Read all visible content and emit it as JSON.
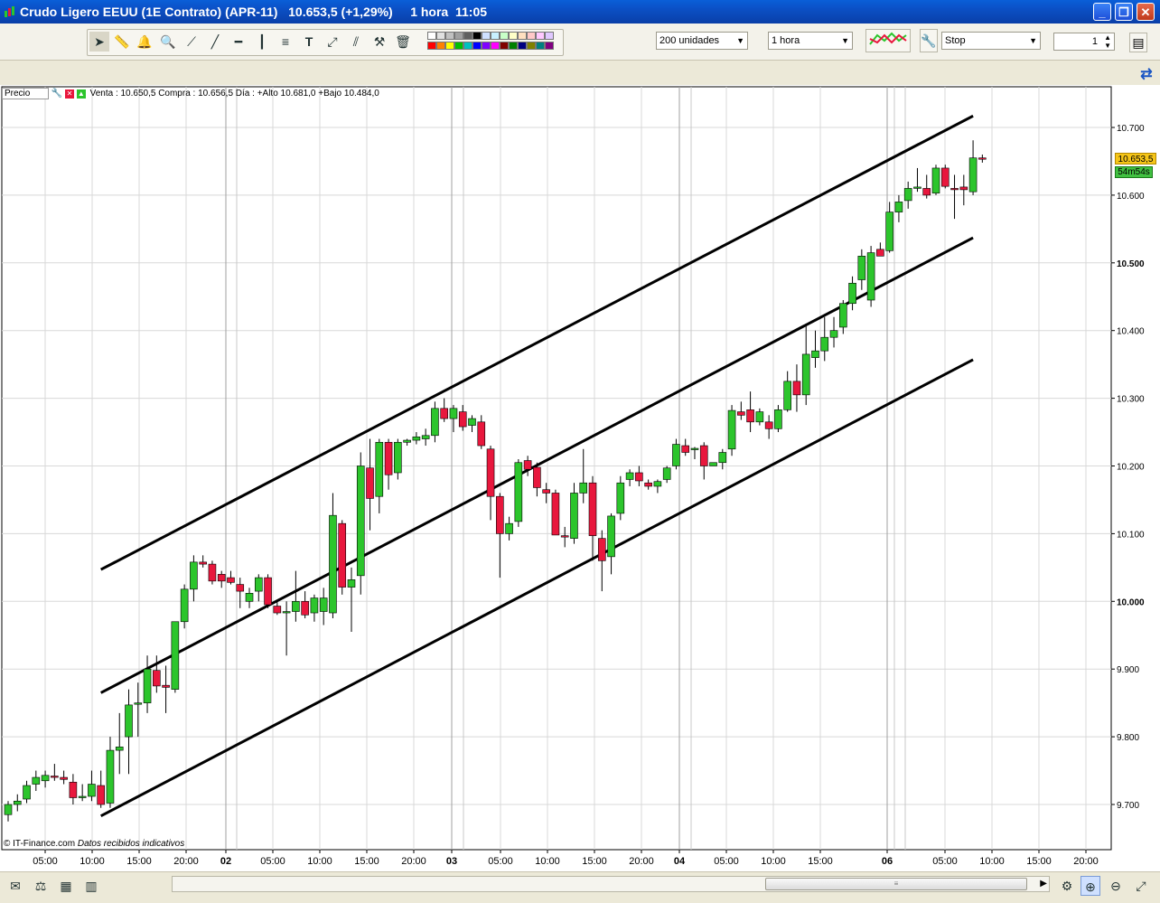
{
  "window": {
    "title_parts": [
      "Crudo Ligero EEUU (1E Contrato) (APR-11)",
      "10.653,5 (+1,29%)",
      "1 hora",
      "11:05"
    ]
  },
  "toolbar": {
    "quantity_select": "200 unidades",
    "period_select": "1 hora",
    "order_type_select": "Stop",
    "order_quantity": "1",
    "tools": [
      "pointer-icon",
      "ruler-icon",
      "alert-bell-icon",
      "zoom-icon",
      "line-icon",
      "trendline-icon",
      "horizontal-line-icon",
      "vertical-line-icon",
      "fibonacci-icon",
      "text-icon",
      "channel-icon",
      "parallel-lines-icon",
      "tools-icon",
      "trash-icon"
    ],
    "palette_colors": [
      "#ffffff",
      "#e0e0e0",
      "#c0c0c0",
      "#a0a0a0",
      "#606060",
      "#000000",
      "#cfe0ff",
      "#c8f0ff",
      "#c8ffc8",
      "#ffffc8",
      "#ffe0c0",
      "#ffc8c8",
      "#ffc8ff",
      "#e0c8ff",
      "#ff0000",
      "#ff8000",
      "#ffff00",
      "#00c000",
      "#00c0c0",
      "#0000ff",
      "#8000ff",
      "#ff00ff",
      "#800000",
      "#008000",
      "#000080",
      "#808000",
      "#008080",
      "#800080"
    ]
  },
  "chart_header": {
    "panel_label": "Precio",
    "quote_line": "Venta : 10.650,5 Compra : 10.656,5  Día : +Alto 10.681,0 +Bajo 10.484,0"
  },
  "chart_footer": {
    "copyright": "© IT-Finance.com",
    "note": "Datos recibidos indicativos"
  },
  "price_axis": {
    "last_price": "10.653,5",
    "countdown": "54m54s",
    "labels": [
      "10.700",
      "10.600",
      "10.500",
      "10.400",
      "10.300",
      "10.200",
      "10.100",
      "10.000",
      "9.900",
      "9.800",
      "9.700"
    ]
  },
  "time_axis": {
    "labels": [
      "05:00",
      "10:00",
      "15:00",
      "20:00",
      "02",
      "05:00",
      "10:00",
      "15:00",
      "20:00",
      "03",
      "05:00",
      "10:00",
      "15:00",
      "20:00",
      "04",
      "05:00",
      "10:00",
      "15:00",
      "06",
      "05:00",
      "10:00",
      "15:00",
      "20:00"
    ],
    "bold_labels": [
      "02",
      "03",
      "04",
      "06"
    ]
  },
  "colors": {
    "bull": "#2cc52c",
    "bear": "#e8173d",
    "grid": "#d8d8d8",
    "channel": "#000000",
    "last_price_bg": "#f5c518",
    "countdown_bg": "#41c041"
  },
  "statusbar": {
    "icons": [
      "mail-icon",
      "scales-icon",
      "calculator-icon",
      "chart-type-icon",
      "zoom-in-icon",
      "zoom-out-icon",
      "expand-icon"
    ]
  },
  "chart_data": {
    "type": "candlestick",
    "title": "Crudo Ligero EEUU (1E Contrato) (APR-11)",
    "timeframe": "1 hora",
    "y_range": [
      9.66,
      10.74
    ],
    "candles": [
      {
        "o": 9.685,
        "h": 9.705,
        "l": 9.675,
        "c": 9.7
      },
      {
        "o": 9.7,
        "h": 9.715,
        "l": 9.69,
        "c": 9.705
      },
      {
        "o": 9.708,
        "h": 9.735,
        "l": 9.702,
        "c": 9.728
      },
      {
        "o": 9.73,
        "h": 9.75,
        "l": 9.72,
        "c": 9.74
      },
      {
        "o": 9.735,
        "h": 9.75,
        "l": 9.725,
        "c": 9.743
      },
      {
        "o": 9.742,
        "h": 9.76,
        "l": 9.735,
        "c": 9.74
      },
      {
        "o": 9.74,
        "h": 9.75,
        "l": 9.73,
        "c": 9.737
      },
      {
        "o": 9.733,
        "h": 9.745,
        "l": 9.7,
        "c": 9.71
      },
      {
        "o": 9.71,
        "h": 9.73,
        "l": 9.705,
        "c": 9.712
      },
      {
        "o": 9.712,
        "h": 9.75,
        "l": 9.705,
        "c": 9.73
      },
      {
        "o": 9.728,
        "h": 9.75,
        "l": 9.695,
        "c": 9.7
      },
      {
        "o": 9.702,
        "h": 9.8,
        "l": 9.695,
        "c": 9.78
      },
      {
        "o": 9.78,
        "h": 9.835,
        "l": 9.745,
        "c": 9.785
      },
      {
        "o": 9.8,
        "h": 9.87,
        "l": 9.745,
        "c": 9.847
      },
      {
        "o": 9.848,
        "h": 9.88,
        "l": 9.8,
        "c": 9.85
      },
      {
        "o": 9.85,
        "h": 9.92,
        "l": 9.835,
        "c": 9.9
      },
      {
        "o": 9.898,
        "h": 9.92,
        "l": 9.865,
        "c": 9.875
      },
      {
        "o": 9.876,
        "h": 9.905,
        "l": 9.835,
        "c": 9.873
      },
      {
        "o": 9.87,
        "h": 9.97,
        "l": 9.865,
        "c": 9.97
      },
      {
        "o": 9.97,
        "h": 10.025,
        "l": 9.96,
        "c": 10.018
      },
      {
        "o": 10.018,
        "h": 10.068,
        "l": 10.0,
        "c": 10.058
      },
      {
        "o": 10.058,
        "h": 10.068,
        "l": 10.05,
        "c": 10.055
      },
      {
        "o": 10.055,
        "h": 10.06,
        "l": 10.025,
        "c": 10.03
      },
      {
        "o": 10.04,
        "h": 10.045,
        "l": 10.02,
        "c": 10.03
      },
      {
        "o": 10.035,
        "h": 10.045,
        "l": 10.025,
        "c": 10.028
      },
      {
        "o": 10.025,
        "h": 10.035,
        "l": 9.99,
        "c": 10.015
      },
      {
        "o": 10.0,
        "h": 10.02,
        "l": 9.99,
        "c": 10.012
      },
      {
        "o": 10.015,
        "h": 10.04,
        "l": 10.0,
        "c": 10.035
      },
      {
        "o": 10.035,
        "h": 10.04,
        "l": 9.99,
        "c": 9.995
      },
      {
        "o": 9.993,
        "h": 10.0,
        "l": 9.98,
        "c": 9.983
      },
      {
        "o": 9.985,
        "h": 10.0,
        "l": 9.92,
        "c": 9.985
      },
      {
        "o": 9.985,
        "h": 10.045,
        "l": 9.97,
        "c": 10.0
      },
      {
        "o": 10.0,
        "h": 10.015,
        "l": 9.975,
        "c": 9.98
      },
      {
        "o": 9.983,
        "h": 10.01,
        "l": 9.97,
        "c": 10.005
      },
      {
        "o": 9.985,
        "h": 10.02,
        "l": 9.965,
        "c": 10.005
      },
      {
        "o": 9.983,
        "h": 10.16,
        "l": 9.975,
        "c": 10.127
      },
      {
        "o": 10.115,
        "h": 10.12,
        "l": 10.01,
        "c": 10.021
      },
      {
        "o": 10.021,
        "h": 10.05,
        "l": 9.955,
        "c": 10.032
      },
      {
        "o": 10.038,
        "h": 10.22,
        "l": 10.01,
        "c": 10.2
      },
      {
        "o": 10.197,
        "h": 10.24,
        "l": 10.105,
        "c": 10.152
      },
      {
        "o": 10.155,
        "h": 10.24,
        "l": 10.13,
        "c": 10.235
      },
      {
        "o": 10.235,
        "h": 10.24,
        "l": 10.165,
        "c": 10.187
      },
      {
        "o": 10.19,
        "h": 10.24,
        "l": 10.18,
        "c": 10.235
      },
      {
        "o": 10.235,
        "h": 10.24,
        "l": 10.23,
        "c": 10.238
      },
      {
        "o": 10.238,
        "h": 10.25,
        "l": 10.232,
        "c": 10.243
      },
      {
        "o": 10.24,
        "h": 10.255,
        "l": 10.23,
        "c": 10.245
      },
      {
        "o": 10.245,
        "h": 10.295,
        "l": 10.235,
        "c": 10.285
      },
      {
        "o": 10.285,
        "h": 10.3,
        "l": 10.265,
        "c": 10.27
      },
      {
        "o": 10.27,
        "h": 10.29,
        "l": 10.25,
        "c": 10.285
      },
      {
        "o": 10.28,
        "h": 10.29,
        "l": 10.252,
        "c": 10.258
      },
      {
        "o": 10.26,
        "h": 10.275,
        "l": 10.25,
        "c": 10.27
      },
      {
        "o": 10.265,
        "h": 10.275,
        "l": 10.225,
        "c": 10.23
      },
      {
        "o": 10.225,
        "h": 10.23,
        "l": 10.12,
        "c": 10.155
      },
      {
        "o": 10.155,
        "h": 10.16,
        "l": 10.035,
        "c": 10.1
      },
      {
        "o": 10.1,
        "h": 10.125,
        "l": 10.09,
        "c": 10.115
      },
      {
        "o": 10.118,
        "h": 10.21,
        "l": 10.11,
        "c": 10.205
      },
      {
        "o": 10.208,
        "h": 10.215,
        "l": 10.185,
        "c": 10.195
      },
      {
        "o": 10.198,
        "h": 10.205,
        "l": 10.155,
        "c": 10.168
      },
      {
        "o": 10.165,
        "h": 10.175,
        "l": 10.145,
        "c": 10.16
      },
      {
        "o": 10.16,
        "h": 10.165,
        "l": 10.1,
        "c": 10.098
      },
      {
        "o": 10.097,
        "h": 10.11,
        "l": 10.08,
        "c": 10.095
      },
      {
        "o": 10.093,
        "h": 10.175,
        "l": 10.085,
        "c": 10.16
      },
      {
        "o": 10.16,
        "h": 10.225,
        "l": 10.145,
        "c": 10.175
      },
      {
        "o": 10.175,
        "h": 10.185,
        "l": 10.06,
        "c": 10.097
      },
      {
        "o": 10.093,
        "h": 10.105,
        "l": 10.015,
        "c": 10.06
      },
      {
        "o": 10.066,
        "h": 10.13,
        "l": 10.04,
        "c": 10.126
      },
      {
        "o": 10.13,
        "h": 10.185,
        "l": 10.12,
        "c": 10.175
      },
      {
        "o": 10.18,
        "h": 10.195,
        "l": 10.17,
        "c": 10.19
      },
      {
        "o": 10.19,
        "h": 10.2,
        "l": 10.17,
        "c": 10.178
      },
      {
        "o": 10.175,
        "h": 10.18,
        "l": 10.165,
        "c": 10.17
      },
      {
        "o": 10.17,
        "h": 10.18,
        "l": 10.16,
        "c": 10.177
      },
      {
        "o": 10.18,
        "h": 10.2,
        "l": 10.175,
        "c": 10.197
      },
      {
        "o": 10.2,
        "h": 10.24,
        "l": 10.195,
        "c": 10.232
      },
      {
        "o": 10.23,
        "h": 10.24,
        "l": 10.215,
        "c": 10.22
      },
      {
        "o": 10.224,
        "h": 10.228,
        "l": 10.21,
        "c": 10.226
      },
      {
        "o": 10.23,
        "h": 10.235,
        "l": 10.18,
        "c": 10.2
      },
      {
        "o": 10.2,
        "h": 10.205,
        "l": 10.2,
        "c": 10.205
      },
      {
        "o": 10.205,
        "h": 10.225,
        "l": 10.195,
        "c": 10.22
      },
      {
        "o": 10.225,
        "h": 10.29,
        "l": 10.215,
        "c": 10.282
      },
      {
        "o": 10.28,
        "h": 10.295,
        "l": 10.268,
        "c": 10.275
      },
      {
        "o": 10.283,
        "h": 10.31,
        "l": 10.25,
        "c": 10.265
      },
      {
        "o": 10.265,
        "h": 10.285,
        "l": 10.26,
        "c": 10.28
      },
      {
        "o": 10.265,
        "h": 10.275,
        "l": 10.24,
        "c": 10.255
      },
      {
        "o": 10.255,
        "h": 10.29,
        "l": 10.25,
        "c": 10.283
      },
      {
        "o": 10.283,
        "h": 10.34,
        "l": 10.28,
        "c": 10.325
      },
      {
        "o": 10.325,
        "h": 10.35,
        "l": 10.28,
        "c": 10.305
      },
      {
        "o": 10.305,
        "h": 10.41,
        "l": 10.29,
        "c": 10.365
      },
      {
        "o": 10.36,
        "h": 10.4,
        "l": 10.345,
        "c": 10.37
      },
      {
        "o": 10.37,
        "h": 10.42,
        "l": 10.355,
        "c": 10.39
      },
      {
        "o": 10.39,
        "h": 10.42,
        "l": 10.375,
        "c": 10.4
      },
      {
        "o": 10.405,
        "h": 10.445,
        "l": 10.395,
        "c": 10.44
      },
      {
        "o": 10.44,
        "h": 10.48,
        "l": 10.43,
        "c": 10.47
      },
      {
        "o": 10.475,
        "h": 10.52,
        "l": 10.46,
        "c": 10.51
      },
      {
        "o": 10.445,
        "h": 10.525,
        "l": 10.435,
        "c": 10.515
      },
      {
        "o": 10.52,
        "h": 10.53,
        "l": 10.51,
        "c": 10.51
      },
      {
        "o": 10.518,
        "h": 10.59,
        "l": 10.515,
        "c": 10.575
      },
      {
        "o": 10.575,
        "h": 10.6,
        "l": 10.56,
        "c": 10.59
      },
      {
        "o": 10.592,
        "h": 10.62,
        "l": 10.58,
        "c": 10.61
      },
      {
        "o": 10.61,
        "h": 10.64,
        "l": 10.605,
        "c": 10.612
      },
      {
        "o": 10.61,
        "h": 10.63,
        "l": 10.595,
        "c": 10.6
      },
      {
        "o": 10.603,
        "h": 10.645,
        "l": 10.6,
        "c": 10.64
      },
      {
        "o": 10.64,
        "h": 10.645,
        "l": 10.61,
        "c": 10.613
      },
      {
        "o": 10.61,
        "h": 10.63,
        "l": 10.565,
        "c": 10.608
      },
      {
        "o": 10.612,
        "h": 10.63,
        "l": 10.585,
        "c": 10.608
      },
      {
        "o": 10.605,
        "h": 10.681,
        "l": 10.6,
        "c": 10.655
      },
      {
        "o": 10.655,
        "h": 10.66,
        "l": 10.648,
        "c": 10.6535
      }
    ],
    "channel_lines": [
      {
        "name": "upper",
        "from": {
          "bar": 10,
          "price": 10.047
        },
        "to": {
          "bar": 104,
          "price": 10.717
        }
      },
      {
        "name": "middle",
        "from": {
          "bar": 10,
          "price": 9.865
        },
        "to": {
          "bar": 104,
          "price": 10.537
        }
      },
      {
        "name": "lower",
        "from": {
          "bar": 10,
          "price": 9.683
        },
        "to": {
          "bar": 104,
          "price": 10.357
        }
      }
    ]
  }
}
